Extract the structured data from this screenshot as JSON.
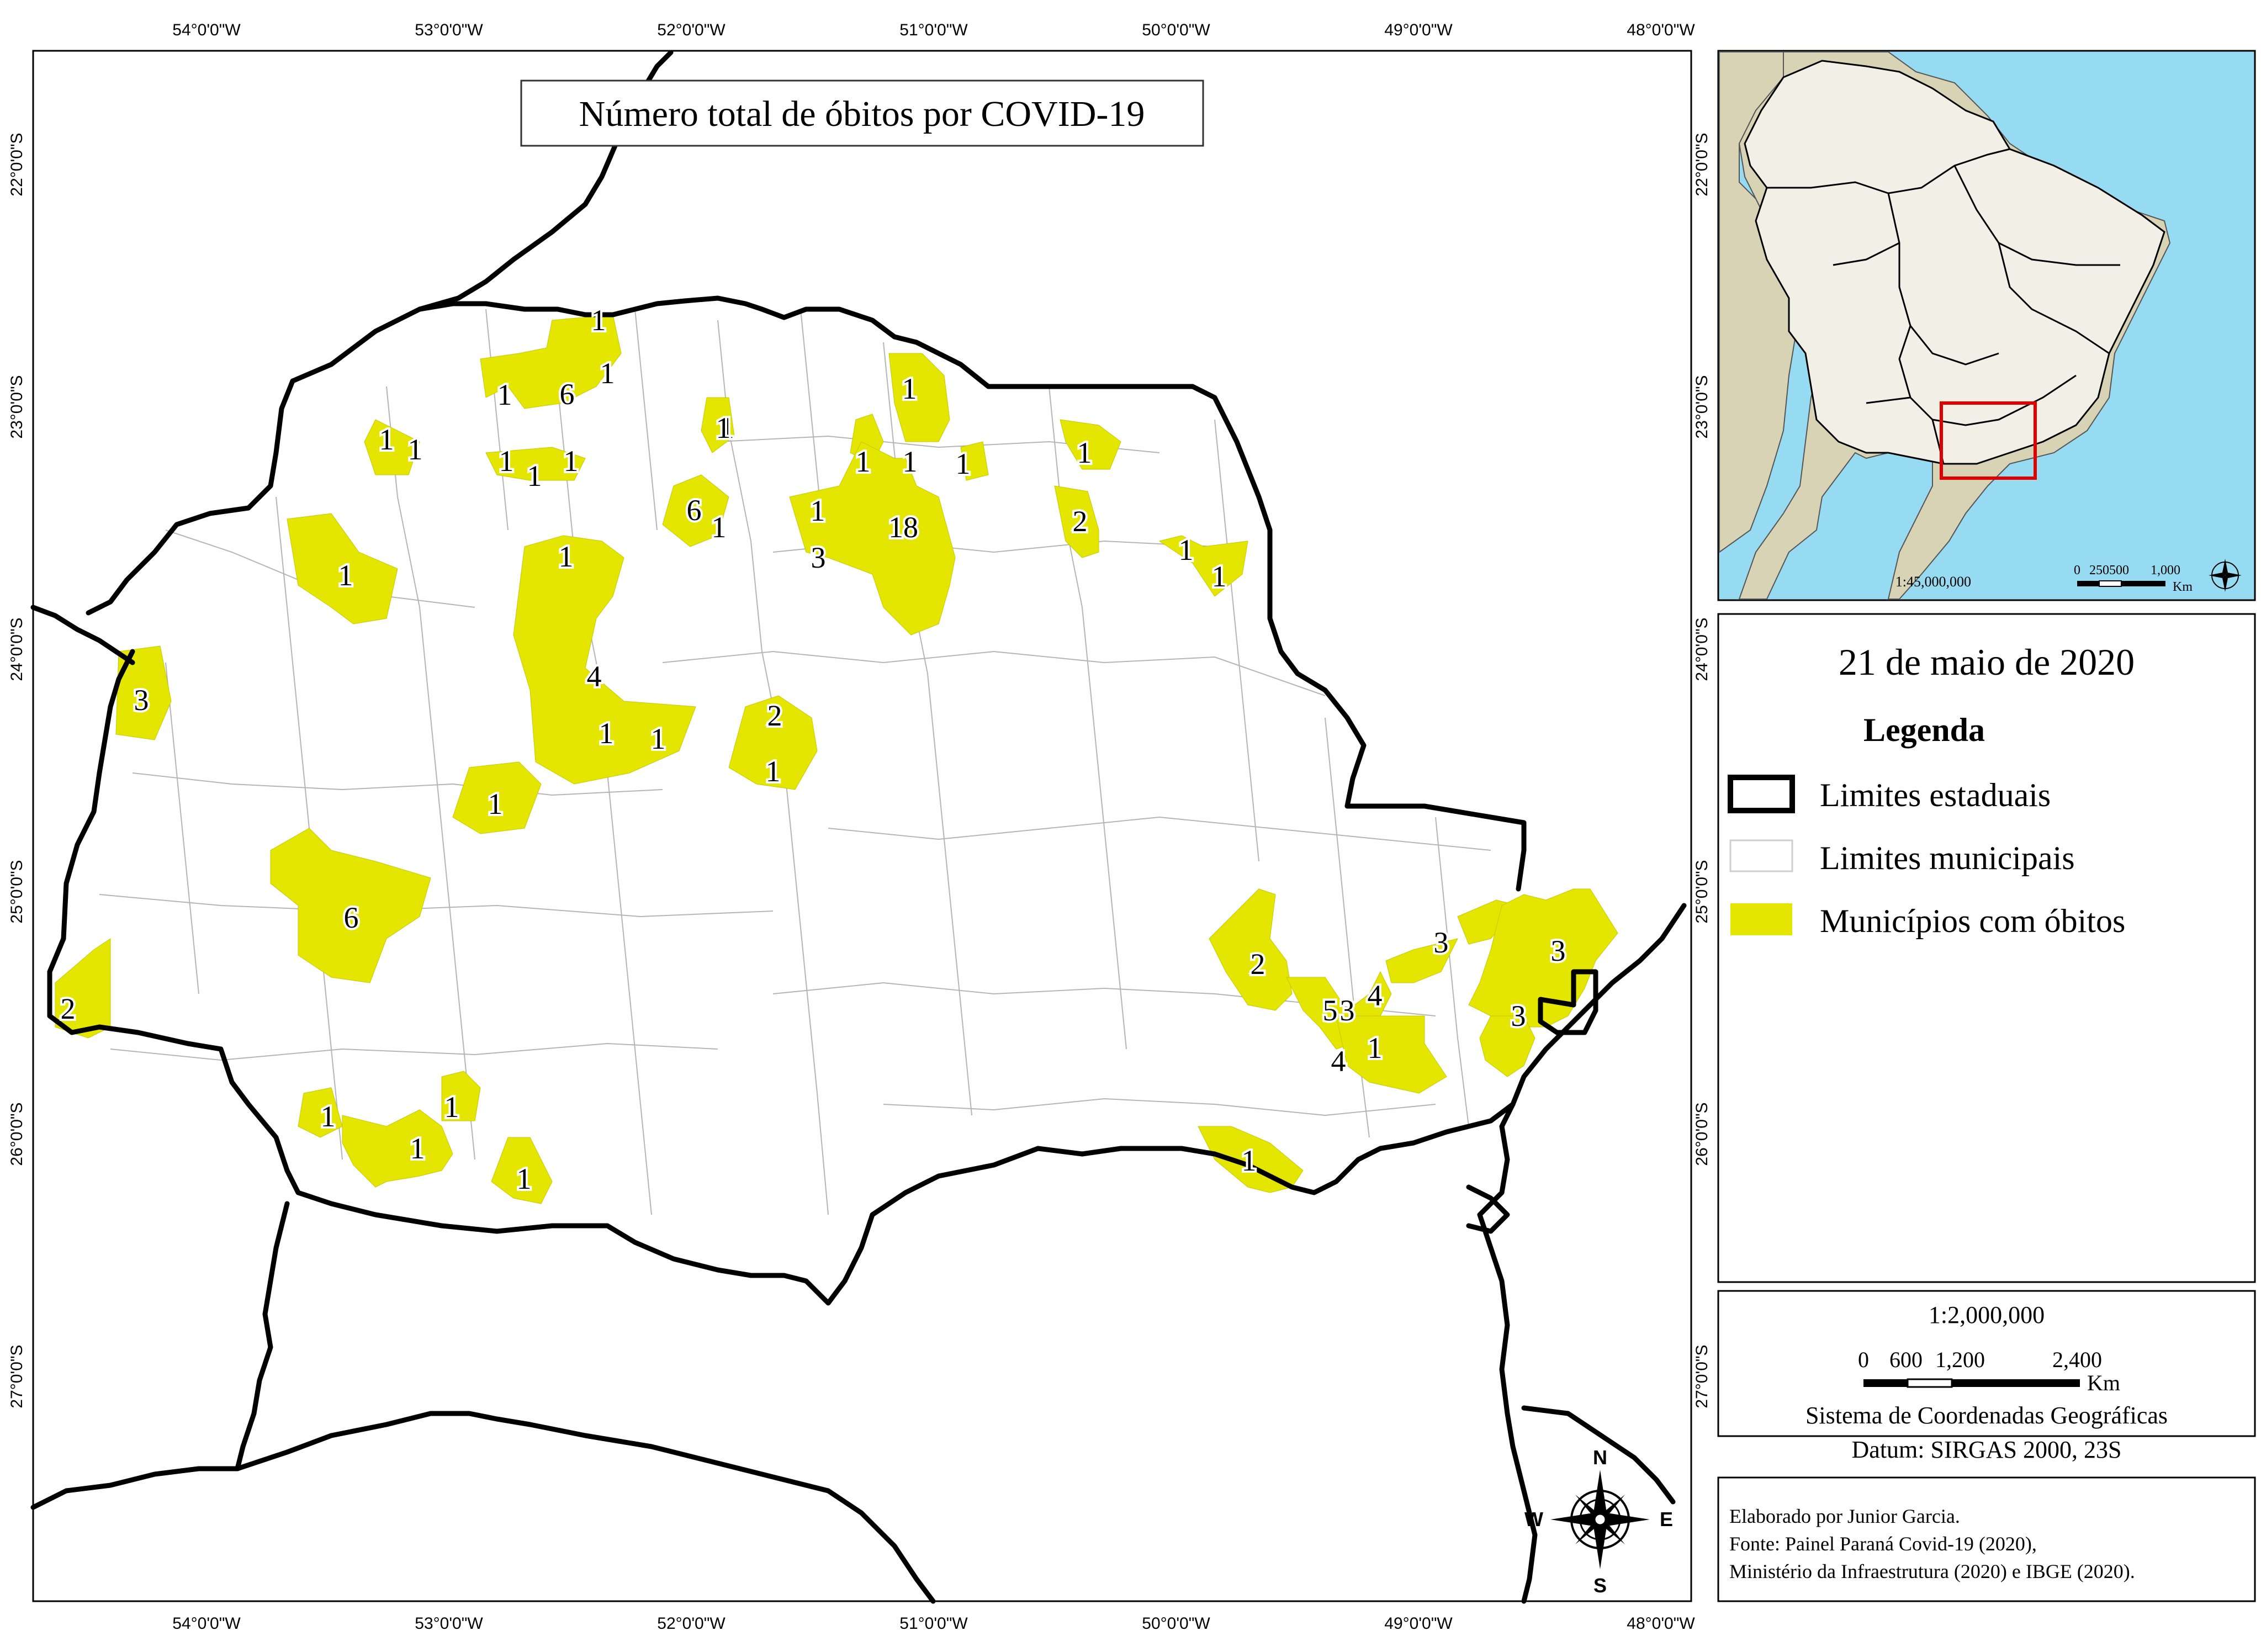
{
  "map": {
    "title": "Número total de óbitos por COVID-19",
    "colors": {
      "highlight": "#e5e600",
      "state_border": "#000000",
      "municipal_border": "#b5b5b5",
      "ocean": "#97dbf2",
      "land_inset": "#d7d3b4",
      "land_brazil": "#f2f0e6",
      "inset_box": "#e00000"
    },
    "lon_labels": [
      "54°0'0\"W",
      "53°0'0\"W",
      "52°0'0\"W",
      "51°0'0\"W",
      "50°0'0\"W",
      "49°0'0\"W",
      "48°0'0\"W"
    ],
    "lat_labels": [
      "22°0'0\"S",
      "23°0'0\"S",
      "24°0'0\"S",
      "25°0'0\"S",
      "26°0'0\"S",
      "27°0'0\"S"
    ],
    "counts": [
      "1",
      "6",
      "1",
      "1",
      "1",
      "1",
      "1",
      "1",
      "1",
      "1",
      "6",
      "1",
      "1",
      "1",
      "3",
      "18",
      "1",
      "1",
      "1",
      "1",
      "1",
      "2",
      "1",
      "1",
      "1",
      "1",
      "4",
      "1",
      "1",
      "2",
      "1",
      "3",
      "1",
      "6",
      "2",
      "2",
      "3",
      "3",
      "5",
      "3",
      "4",
      "4",
      "1",
      "3",
      "1",
      "1",
      "1",
      "1",
      "1"
    ]
  },
  "compass": {
    "n": "N",
    "s": "S",
    "e": "E",
    "w": "W"
  },
  "inset": {
    "lat_labels": [
      "22°0'0\"S",
      "23°0'0\"S"
    ],
    "scale_text": "1:45,000,000",
    "scale_ticks": [
      "0",
      "250500",
      "1,000"
    ],
    "scale_unit": "Km"
  },
  "legend": {
    "date": "21 de maio de 2020",
    "heading": "Legenda",
    "items": [
      {
        "label": "Limites estaduais",
        "icon": "state-limit-swatch"
      },
      {
        "label": "Limites municipais",
        "icon": "municipal-limit-swatch"
      },
      {
        "label": "Municípios com óbitos",
        "icon": "deaths-swatch"
      }
    ],
    "lat_labels": [
      "24°0'0\"S",
      "25°0'0\"S",
      "26°0'0\"S",
      "27°0'0\"S"
    ]
  },
  "scale_panel": {
    "ratio": "1:2,000,000",
    "ticks": [
      "0",
      "600",
      "1,200",
      "2,400"
    ],
    "unit": "Km",
    "crs": "Sistema de Coordenadas Geográficas",
    "datum": "Datum: SIRGAS 2000, 23S"
  },
  "credits": {
    "line1": "Elaborado por Junior Garcia.",
    "line2": "Fonte: Painel Paraná Covid-19 (2020),",
    "line3": "Ministério da Infraestrutura (2020) e IBGE (2020)."
  }
}
